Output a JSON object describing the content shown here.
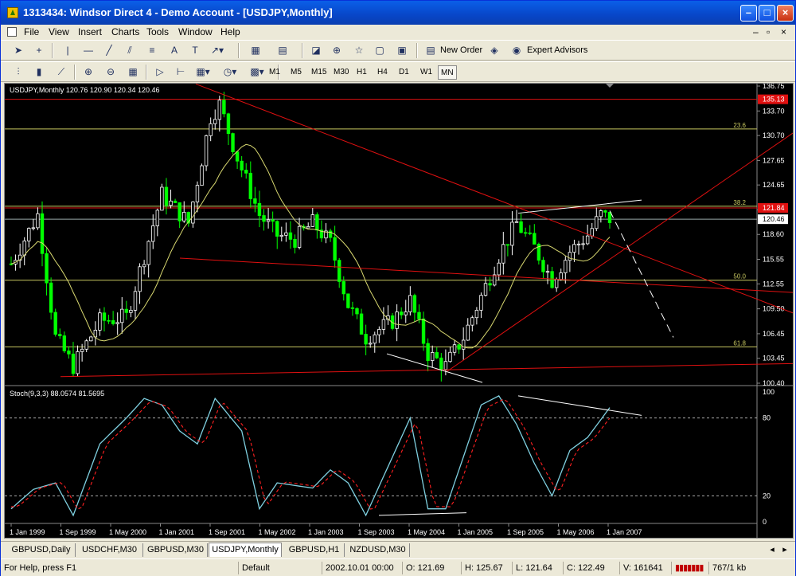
{
  "window": {
    "title": "1313434: Windsor Direct 4 - Demo Account - [USDJPY,Monthly]"
  },
  "menu": [
    "File",
    "View",
    "Insert",
    "Charts",
    "Tools",
    "Window",
    "Help"
  ],
  "toolbar": {
    "new_order": "New Order",
    "expert_advisors": "Expert Advisors"
  },
  "timeframes": [
    "M1",
    "M5",
    "M15",
    "M30",
    "H1",
    "H4",
    "D1",
    "W1",
    "MN"
  ],
  "active_timeframe": "MN",
  "chart": {
    "info": "USDJPY,Monthly  120.76 120.90 120.34 120.46",
    "price_ticks": [
      "136.75",
      "133.70",
      "130.70",
      "127.65",
      "124.65",
      "121.60",
      "118.60",
      "115.55",
      "112.55",
      "109.50",
      "106.45",
      "103.45",
      "100.40"
    ],
    "price_values": [
      136.75,
      133.7,
      130.7,
      127.65,
      124.65,
      121.6,
      118.6,
      115.55,
      112.55,
      109.5,
      106.45,
      103.45,
      100.4
    ],
    "price_min": 100.4,
    "price_max": 136.75,
    "red_level_label": "135.13",
    "red_level_value": 135.13,
    "red_level2_label": "121.84",
    "red_level2_value": 121.84,
    "bid_label": "120.46",
    "bid_value": 120.46,
    "fibo": [
      {
        "label": "23.6",
        "value": 131.5
      },
      {
        "label": "38.2",
        "value": 122.05
      },
      {
        "label": "50.0",
        "value": 113.0
      },
      {
        "label": "61.8",
        "value": 104.85
      }
    ],
    "stoch_info": "Stoch(9,3,3) 88.0574 81.5695",
    "stoch_ticks": [
      "100",
      "80",
      "20",
      "0"
    ],
    "stoch_levels": [
      80,
      20
    ],
    "date_ticks": [
      "1 Jan 1999",
      "1 Sep 1999",
      "1 May 2000",
      "1 Jan 2001",
      "1 Sep 2001",
      "1 May 2002",
      "1 Jan 2003",
      "1 Sep 2003",
      "1 May 2004",
      "1 Jan 2005",
      "1 Sep 2005",
      "1 May 2006",
      "1 Jan 2007"
    ],
    "colors": {
      "bull": "#ffffff",
      "bear": "#00ff00",
      "ma": "#d8d870",
      "trend": "#e01010",
      "stoch_main": "#7fd0e0",
      "stoch_signal": "#ff2020",
      "fibo": "#c8c860"
    }
  },
  "tabs": [
    "GBPUSD,Daily",
    "USDCHF,M30",
    "GBPUSD,M30",
    "USDJPY,Monthly",
    "GBPUSD,H1",
    "NZDUSD,M30"
  ],
  "active_tab": "USDJPY,Monthly",
  "status": {
    "help": "For Help, press F1",
    "profile": "Default",
    "datetime": "2002.10.01 00:00",
    "open": "O: 121.69",
    "high": "H: 125.67",
    "low": "L: 121.64",
    "close": "C: 122.49",
    "volume": "V: 161641",
    "traffic": "767/1 kb"
  }
}
